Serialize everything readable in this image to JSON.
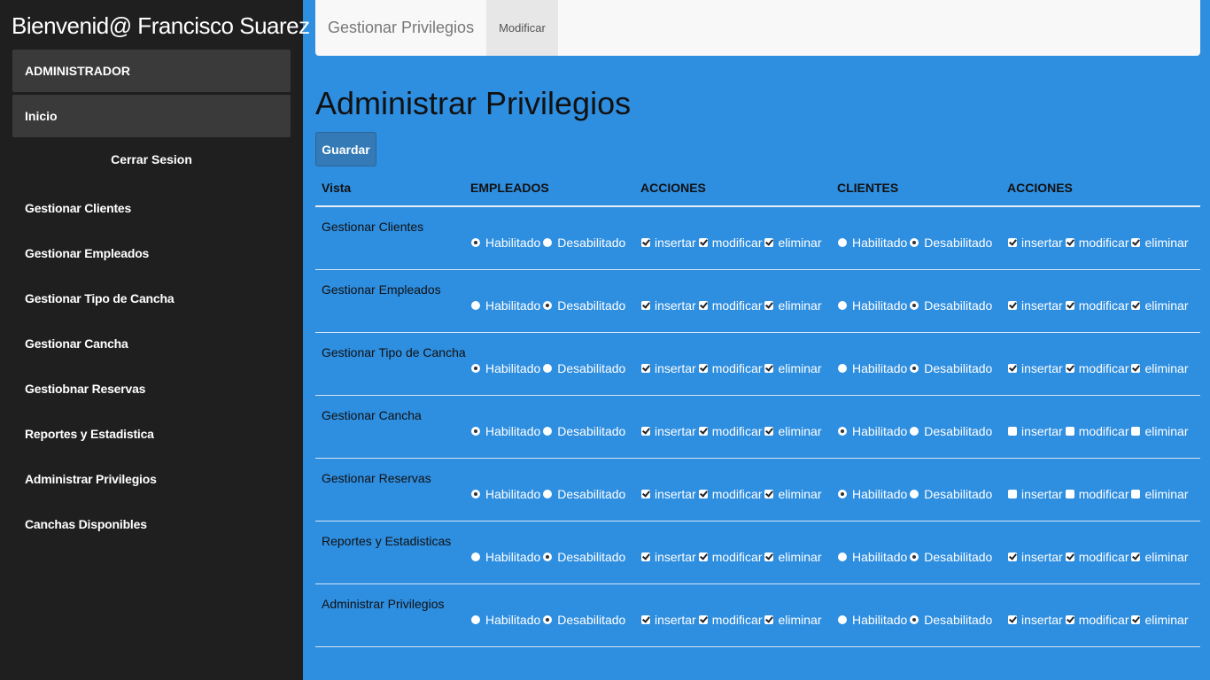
{
  "sidebar": {
    "welcome": "Bienvenid@ Francisco Suarez",
    "role_box": "ADMINISTRADOR",
    "home_box": "Inicio",
    "logout": "Cerrar Sesion",
    "nav": [
      "Gestionar Clientes",
      "Gestionar Empleados",
      "Gestionar Tipo de Cancha",
      "Gestionar Cancha",
      "Gestiobnar Reservas",
      "Reportes y Estadistica",
      "Administrar Privilegios",
      "Canchas Disponibles"
    ]
  },
  "topbar": {
    "brand": "Gestionar Privilegios",
    "tab": "Modificar"
  },
  "page": {
    "title": "Administrar Privilegios",
    "save_label": "Guardar"
  },
  "table": {
    "headers": [
      "Vista",
      "EMPLEADOS",
      "ACCIONES",
      "CLIENTES",
      "ACCIONES"
    ],
    "radio_labels": [
      "Habilitado",
      "Desabilitado"
    ],
    "action_labels": [
      "insertar",
      "modificar",
      "eliminar"
    ],
    "rows": [
      {
        "vista": "Gestionar Clientes",
        "empleados": "Habilitado",
        "emp_actions": [
          true,
          true,
          true
        ],
        "clientes": "Desabilitado",
        "cli_actions": [
          true,
          true,
          true
        ]
      },
      {
        "vista": "Gestionar Empleados",
        "empleados": "Desabilitado",
        "emp_actions": [
          true,
          true,
          true
        ],
        "clientes": "Desabilitado",
        "cli_actions": [
          true,
          true,
          true
        ]
      },
      {
        "vista": "Gestionar Tipo de Cancha",
        "empleados": "Habilitado",
        "emp_actions": [
          true,
          true,
          true
        ],
        "clientes": "Desabilitado",
        "cli_actions": [
          true,
          true,
          true
        ]
      },
      {
        "vista": "Gestionar Cancha",
        "empleados": "Habilitado",
        "emp_actions": [
          true,
          true,
          true
        ],
        "clientes": "Habilitado",
        "cli_actions": [
          false,
          false,
          false
        ]
      },
      {
        "vista": "Gestionar Reservas",
        "empleados": "Habilitado",
        "emp_actions": [
          true,
          true,
          true
        ],
        "clientes": "Habilitado",
        "cli_actions": [
          false,
          false,
          false
        ]
      },
      {
        "vista": "Reportes y Estadisticas",
        "empleados": "Desabilitado",
        "emp_actions": [
          true,
          true,
          true
        ],
        "clientes": "Desabilitado",
        "cli_actions": [
          true,
          true,
          true
        ]
      },
      {
        "vista": "Administrar Privilegios",
        "empleados": "Desabilitado",
        "emp_actions": [
          true,
          true,
          true
        ],
        "clientes": "Desabilitado",
        "cli_actions": [
          true,
          true,
          true
        ]
      }
    ]
  },
  "colors": {
    "sidebar_bg": "#1f1f1f",
    "main_bg": "#2e8ee0",
    "button_bg": "#337ab7"
  }
}
